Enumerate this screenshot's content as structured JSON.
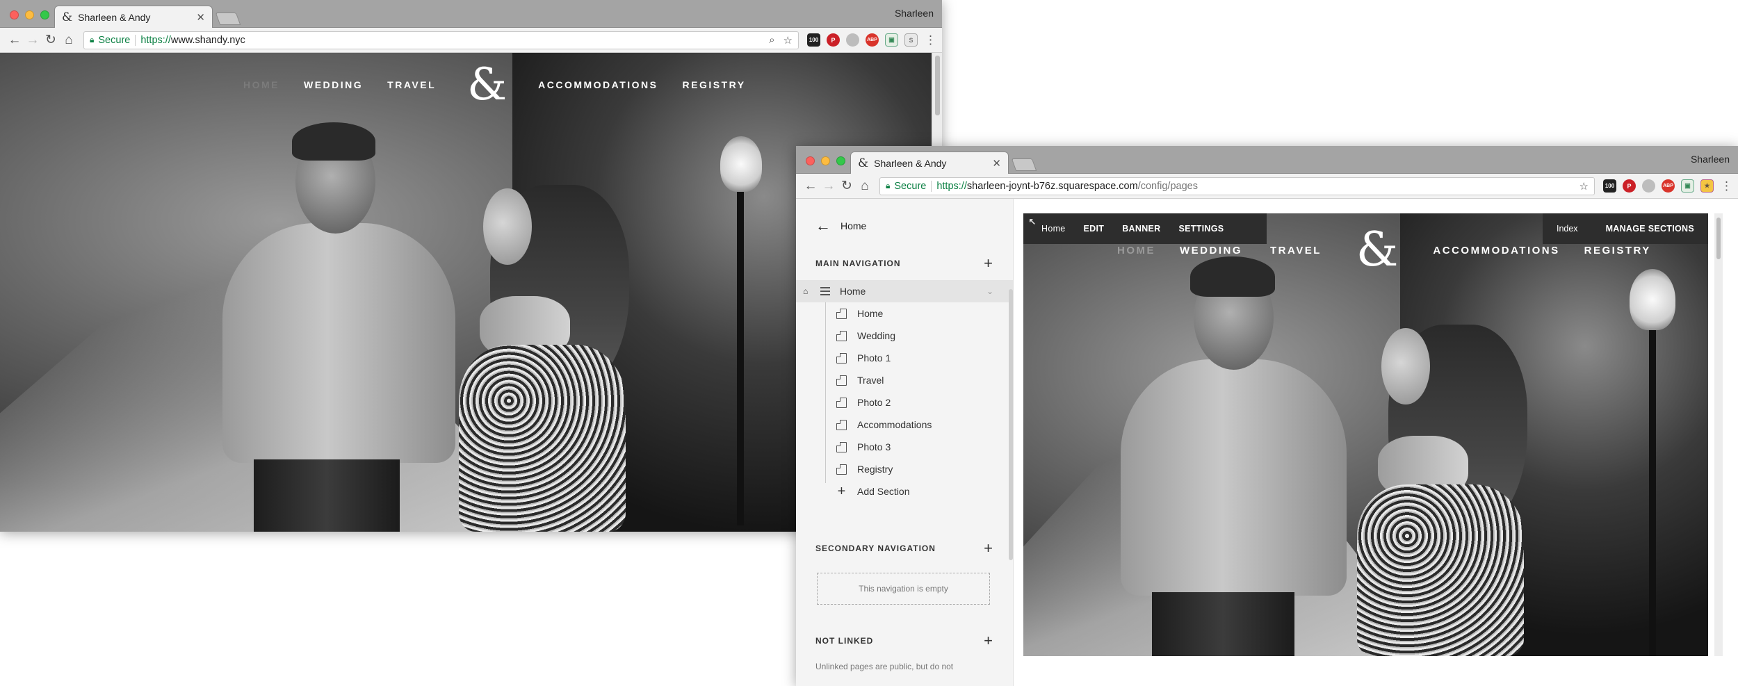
{
  "window1": {
    "tab_title": "Sharleen & Andy",
    "tab_favicon": "&",
    "profile_name": "Sharleen",
    "address": {
      "secure_label": "Secure",
      "scheme": "https://",
      "host": "www.shandy.nyc",
      "path": ""
    },
    "site_nav": {
      "items": [
        "HOME",
        "WEDDING",
        "TRAVEL",
        "ACCOMMODATIONS",
        "REGISTRY"
      ],
      "logo": "&",
      "active": "HOME"
    }
  },
  "window2": {
    "tab_title": "Sharleen & Andy",
    "tab_favicon": "&",
    "profile_name": "Sharleen",
    "address": {
      "secure_label": "Secure",
      "scheme": "https://",
      "host": "sharleen-joynt-b76z.squarespace.com",
      "path": "/config/pages"
    },
    "sidebar": {
      "back_label": "Home",
      "main_nav_heading": "MAIN NAVIGATION",
      "main_nav_item": {
        "label": "Home"
      },
      "pages": [
        "Home",
        "Wedding",
        "Photo 1",
        "Travel",
        "Photo 2",
        "Accommodations",
        "Photo 3",
        "Registry"
      ],
      "add_section": "Add Section",
      "secondary_nav_heading": "SECONDARY NAVIGATION",
      "secondary_empty": "This navigation is empty",
      "not_linked_heading": "NOT LINKED",
      "not_linked_note": "Unlinked pages are public, but do not"
    },
    "edit_bar": {
      "page": "Home",
      "edit": "EDIT",
      "banner": "BANNER",
      "settings": "SETTINGS"
    },
    "right_bar": {
      "index": "Index",
      "manage": "MANAGE SECTIONS"
    },
    "site_nav": {
      "items": [
        "HOME",
        "WEDDING",
        "TRAVEL",
        "ACCOMMODATIONS",
        "REGISTRY"
      ],
      "logo": "&"
    }
  },
  "icons": [
    "back-arrow-icon",
    "forward-arrow-icon",
    "reload-icon",
    "home-icon",
    "lock-icon",
    "search-icon",
    "star-icon",
    "menu-dots-icon",
    "tab-close-icon",
    "plus-icon",
    "page-icon",
    "stack-icon",
    "expand-icon"
  ],
  "colors": {
    "secure_green": "#0b8043",
    "editbar_bg": "#2d2d2d",
    "sidebar_bg": "#f4f4f4",
    "tabbar": "#a4a4a4"
  }
}
